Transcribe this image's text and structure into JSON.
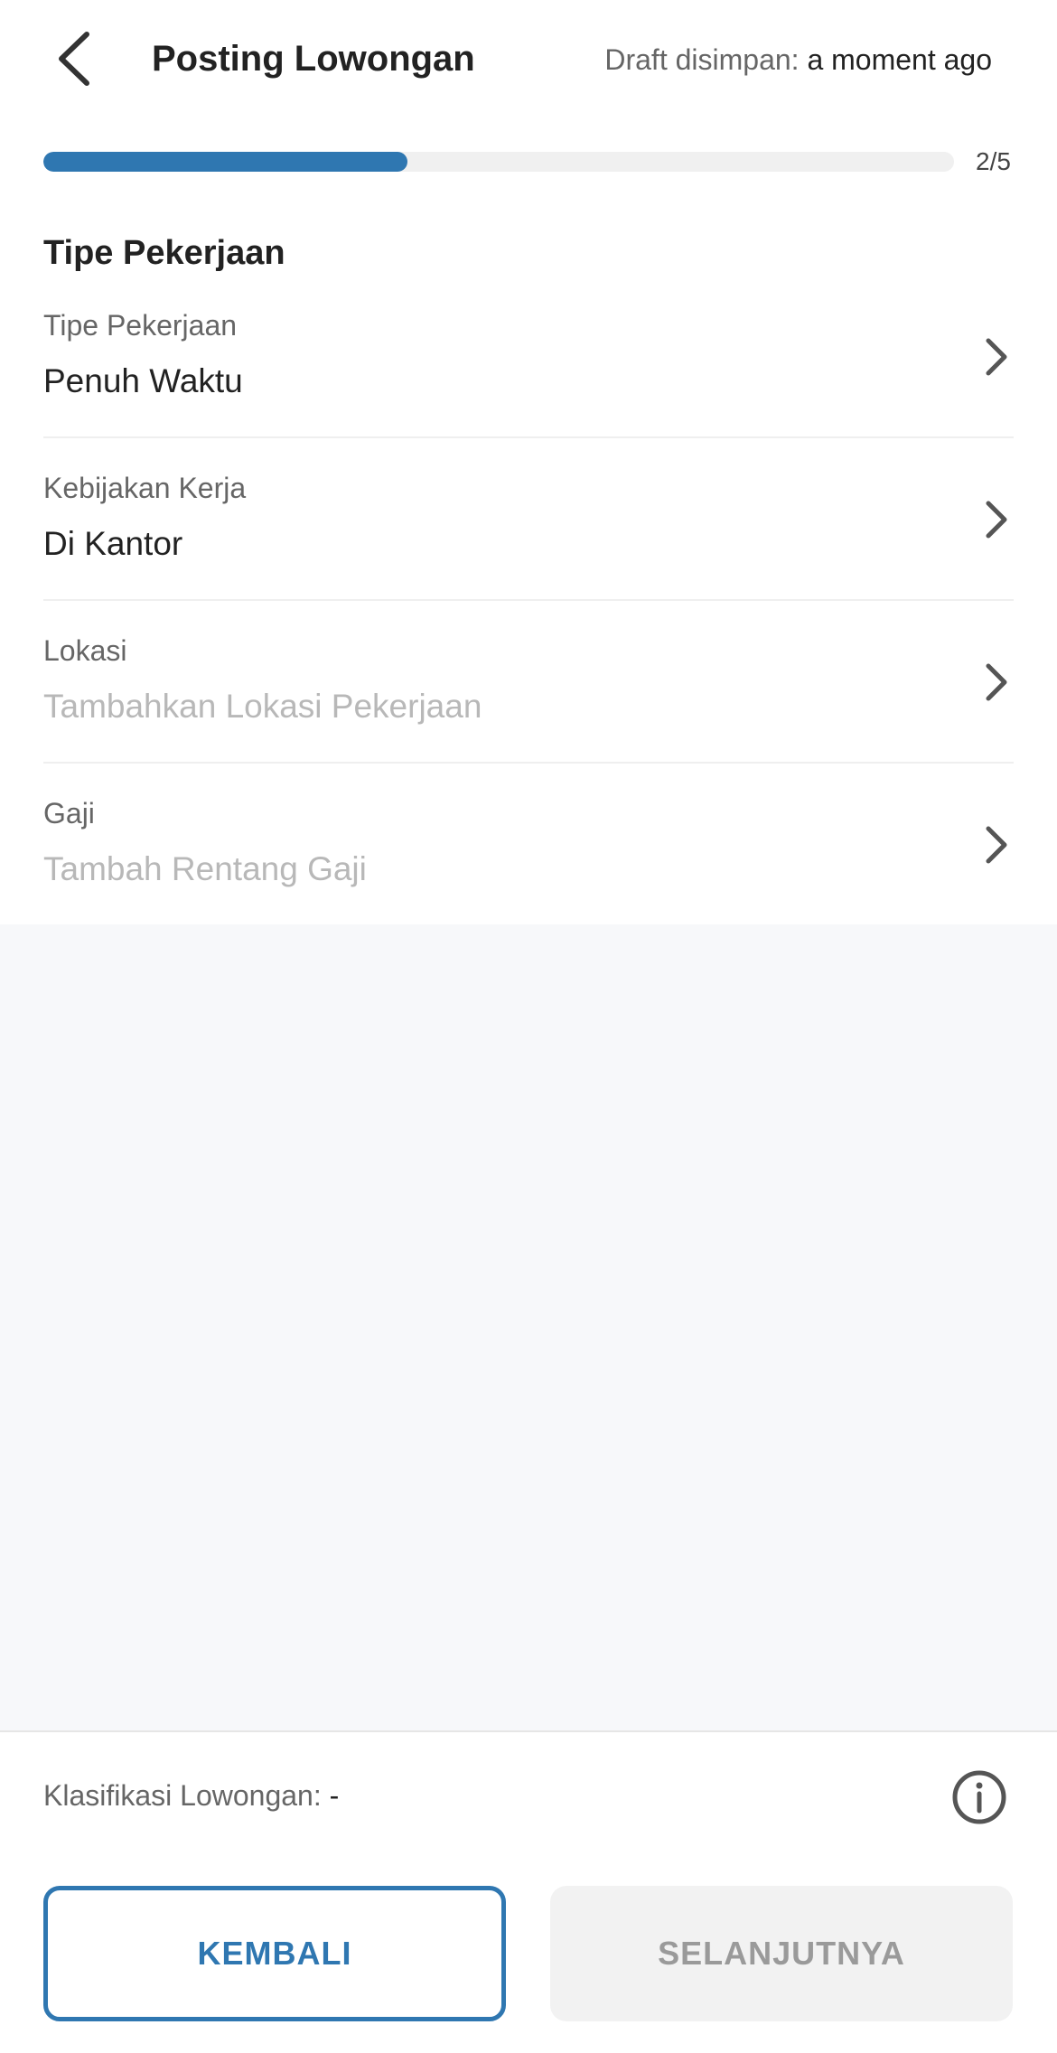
{
  "header": {
    "title": "Posting Lowongan",
    "draft_label": "Draft disimpan:",
    "draft_time": "a moment ago",
    "back_icon": "chevron-left-icon"
  },
  "progress": {
    "current": 2,
    "total": 5,
    "fraction": 0.4,
    "label": "2/5"
  },
  "section": {
    "title": "Tipe Pekerjaan"
  },
  "fields": [
    {
      "label": "Tipe Pekerjaan",
      "value": "Penuh Waktu",
      "placeholder": false
    },
    {
      "label": "Kebijakan Kerja",
      "value": "Di Kantor",
      "placeholder": false
    },
    {
      "label": "Lokasi",
      "value": "Tambahkan Lokasi Pekerjaan",
      "placeholder": true
    },
    {
      "label": "Gaji",
      "value": "Tambah Rentang Gaji",
      "placeholder": true
    }
  ],
  "footer": {
    "klasifikasi_label": "Klasifikasi Lowongan:",
    "klasifikasi_value": "-",
    "info_icon": "info-icon",
    "back_button": "KEMBALI",
    "next_button": "SELANJUTNYA"
  },
  "colors": {
    "accent": "#2f77b1",
    "placeholder": "#b8b8b8",
    "disabled_bg": "#f2f2f2",
    "disabled_text": "#9a9a9a"
  }
}
